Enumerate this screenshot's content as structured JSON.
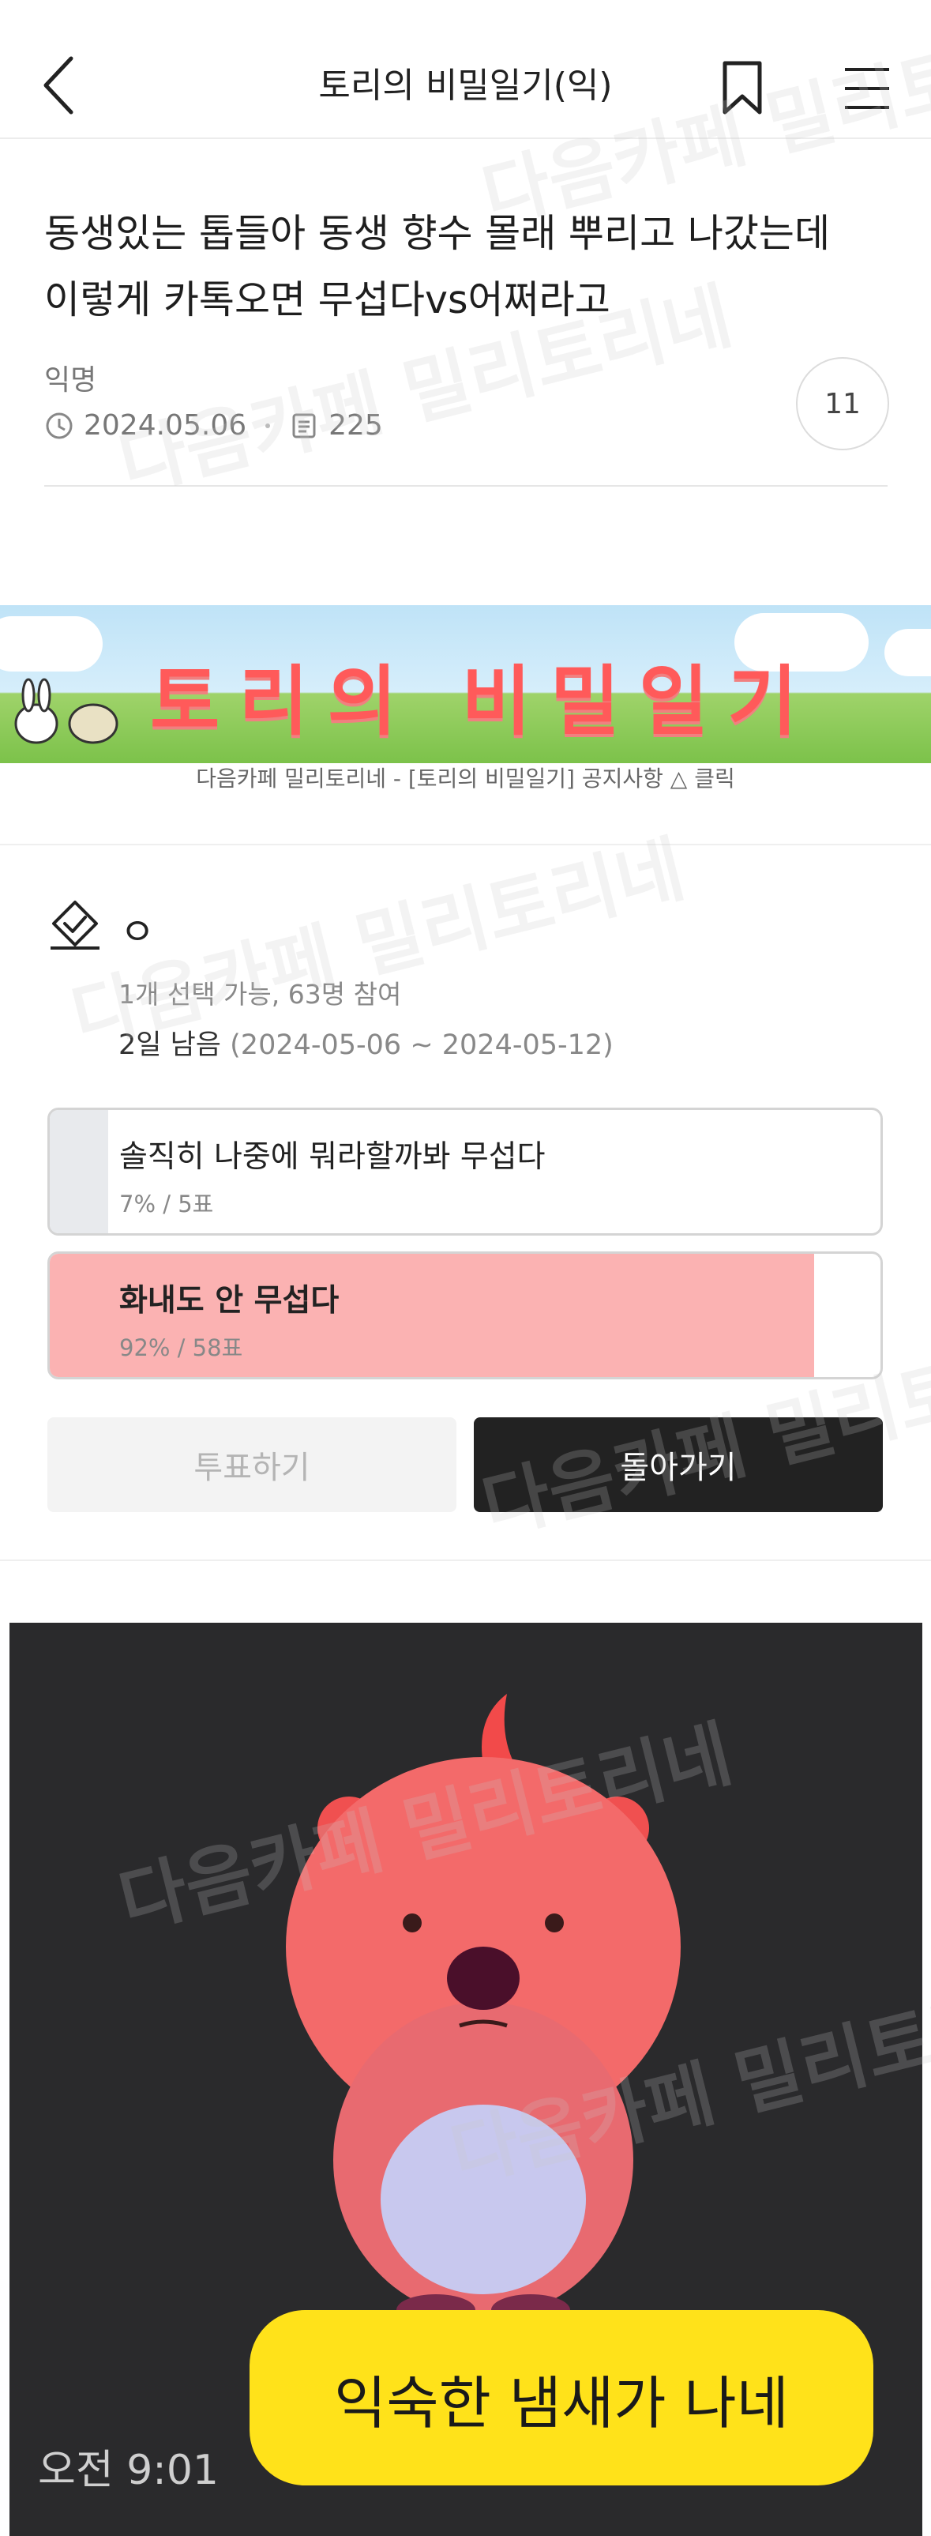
{
  "header": {
    "title": "토리의 비밀일기(익)"
  },
  "post": {
    "title": "동생있는 톱들아 동생 향수 몰래 뿌리고 나갔는데 이렇게 카톡오면 무섭다vs어쩌라고",
    "author": "익명",
    "date": "2024.05.06",
    "views": "225",
    "comments": "11"
  },
  "banner": {
    "text": "토리의 비밀일기",
    "caption": "다음카페 밀리토리네 - [토리의 비밀일기] 공지사항 △ 클릭"
  },
  "poll": {
    "title": "ㅇ",
    "info": "1개 선택 가능, 63명 참여",
    "remaining": "2일 남음",
    "period": "(2024-05-06 ~ 2024-05-12)",
    "options": [
      {
        "label": "솔직히 나중에 뭐라할까봐 무섭다",
        "result": "7% / 5표",
        "percent": 7
      },
      {
        "label": "화내도 안 무섭다",
        "result": "92% / 58표",
        "percent": 92
      }
    ],
    "vote_button": "투표하기",
    "back_button": "돌아가기"
  },
  "image": {
    "caption": "익숙한 냄새가 나네",
    "time": "오전 9:01"
  },
  "watermark": "다음카페 밀리토리네",
  "colors": {
    "selected_fill": "#fbb2b2",
    "unselected_fill": "#e8eaed",
    "caption_bubble": "#ffe21a"
  },
  "icons": [
    "back-arrow-icon",
    "bookmark-icon",
    "menu-icon",
    "clock-icon",
    "views-icon",
    "poll-check-icon"
  ]
}
